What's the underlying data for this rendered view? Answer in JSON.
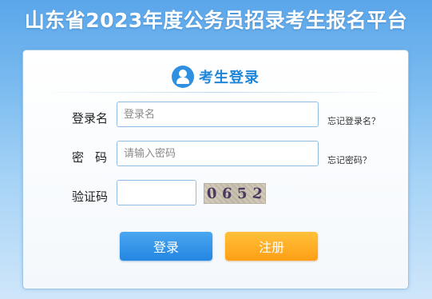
{
  "site": {
    "title": "山东省2023年度公务员招录考生报名平台"
  },
  "login": {
    "header_title": "考生登录",
    "username": {
      "label": "登录名",
      "placeholder": "登录名",
      "value": ""
    },
    "password": {
      "label": "密码",
      "placeholder": "请输入密码",
      "value": ""
    },
    "captcha": {
      "label": "验证码",
      "value": "",
      "image_text": [
        "0",
        "6",
        "5",
        "2"
      ]
    },
    "forgot_username": "忘记登录名？",
    "forgot_password": "忘记密码？",
    "login_button": "登录",
    "register_button": "注册"
  },
  "colors": {
    "header_blue": "#1f86d8",
    "login_button": "#2386e2",
    "register_button": "#ff9f16"
  }
}
